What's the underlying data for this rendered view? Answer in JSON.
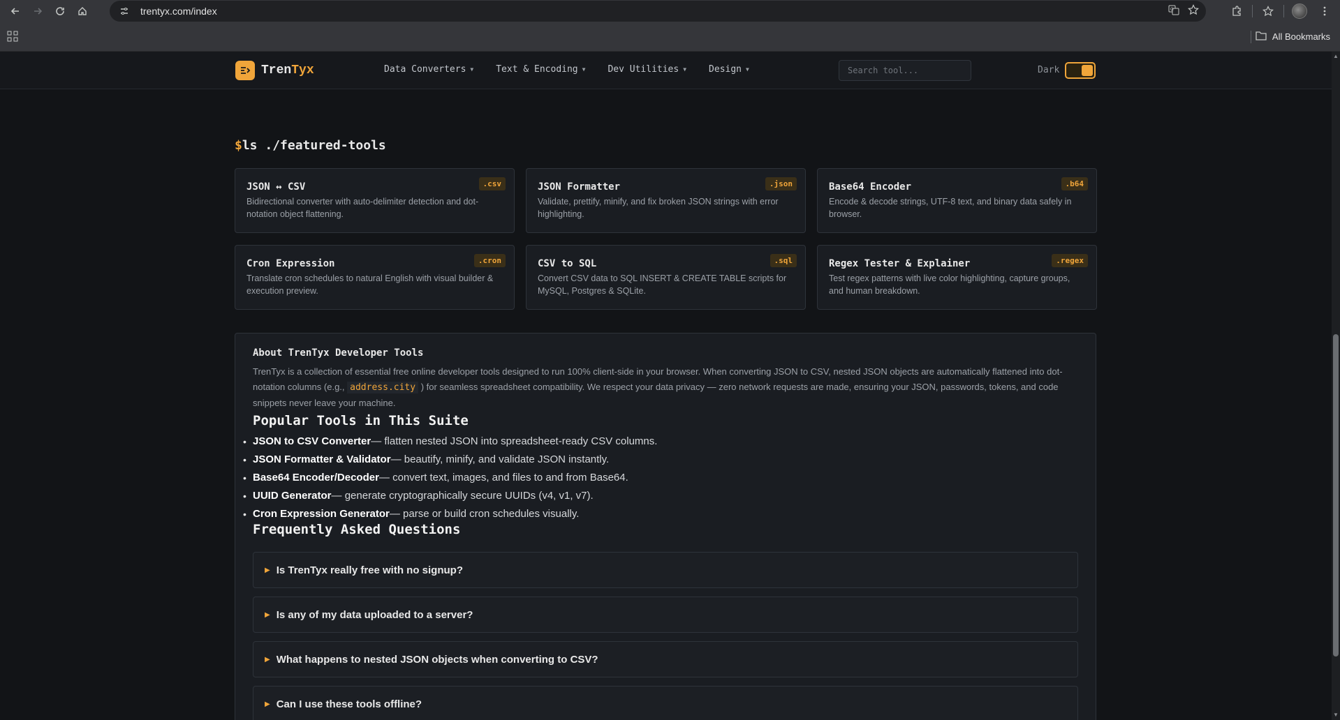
{
  "browser": {
    "url": "trentyx.com/index",
    "bookmarks_label": "All Bookmarks",
    "icons": [
      "back-icon",
      "forward-icon",
      "reload-icon",
      "home-icon",
      "site-info-icon",
      "translate-icon",
      "star-icon",
      "extensions-icon",
      "bookmark-star-icon",
      "menu-icon",
      "apps-icon",
      "folder-icon"
    ]
  },
  "header": {
    "logo_part1": "Tren",
    "logo_part2": "Tyx",
    "nav": [
      "Data Converters",
      "Text & Encoding",
      "Dev Utilities",
      "Design"
    ],
    "search_placeholder": "Search tool...",
    "theme_label": "Dark",
    "theme_dark_on": true
  },
  "featured": {
    "prompt": "$",
    "title": "ls ./featured-tools",
    "tools": [
      {
        "name": "JSON ↔ CSV",
        "ext": ".csv",
        "desc": "Bidirectional converter with auto-delimiter detection and dot-notation object flattening."
      },
      {
        "name": "JSON Formatter",
        "ext": ".json",
        "desc": "Validate, prettify, minify, and fix broken JSON strings with error highlighting."
      },
      {
        "name": "Base64 Encoder",
        "ext": ".b64",
        "desc": "Encode & decode strings, UTF-8 text, and binary data safely in browser."
      },
      {
        "name": "Cron Expression",
        "ext": ".cron",
        "desc": "Translate cron schedules to natural English with visual builder & execution preview."
      },
      {
        "name": "CSV to SQL",
        "ext": ".sql",
        "desc": "Convert CSV data to SQL INSERT & CREATE TABLE scripts for MySQL, Postgres & SQLite."
      },
      {
        "name": "Regex Tester & Explainer",
        "ext": ".regex",
        "desc": "Test regex patterns with live color highlighting, capture groups, and human breakdown."
      }
    ]
  },
  "about": {
    "title": "About TrenTyx Developer Tools",
    "text_before": "TrenTyx is a collection of essential free online developer tools designed to run 100% client-side in your browser. When converting JSON to CSV, nested JSON objects are automatically flattened into dot-notation columns (e.g.,",
    "code": "address.city",
    "text_after": ") for seamless spreadsheet compatibility. We respect your data privacy — zero network requests are made, ensuring your JSON, passwords, tokens, and code snippets never leave your machine.",
    "popular_heading": "Popular Tools in This Suite",
    "popular": [
      {
        "name": "JSON to CSV Converter",
        "desc": " — flatten nested JSON into spreadsheet-ready CSV columns."
      },
      {
        "name": "JSON Formatter & Validator",
        "desc": " — beautify, minify, and validate JSON instantly."
      },
      {
        "name": "Base64 Encoder/Decoder",
        "desc": " — convert text, images, and files to and from Base64."
      },
      {
        "name": "UUID Generator",
        "desc": " — generate cryptographically secure UUIDs (v4, v1, v7)."
      },
      {
        "name": "Cron Expression Generator",
        "desc": " — parse or build cron schedules visually."
      }
    ],
    "faq_heading": "Frequently Asked Questions",
    "faq": [
      "Is TrenTyx really free with no signup?",
      "Is any of my data uploaded to a server?",
      "What happens to nested JSON objects when converting to CSV?",
      "Can I use these tools offline?"
    ]
  },
  "colors": {
    "accent": "#f0a53a",
    "background": "#121417",
    "card": "#1a1d22"
  }
}
